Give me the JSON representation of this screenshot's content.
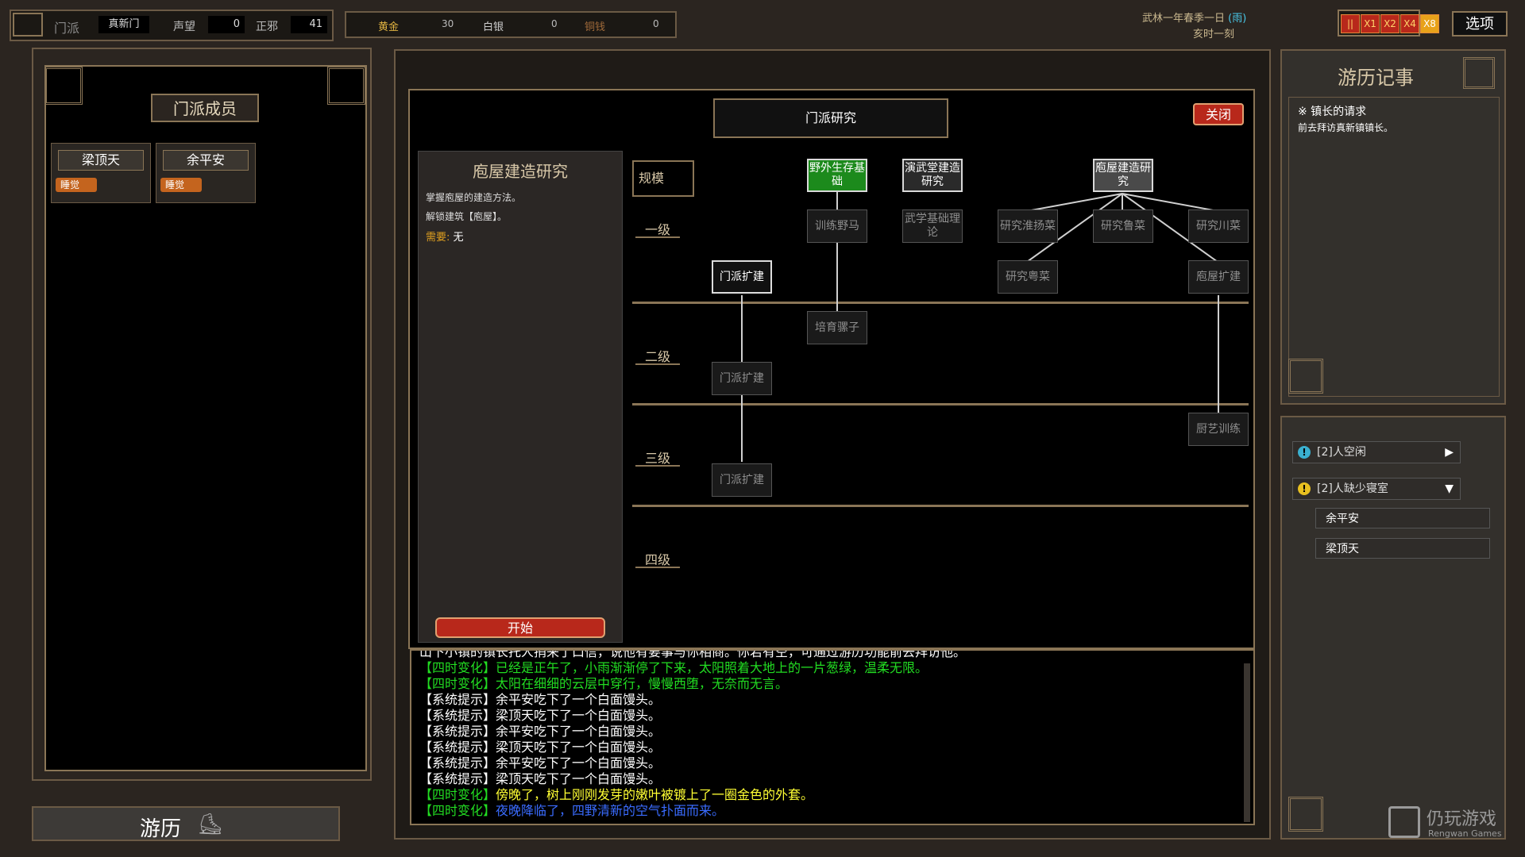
{
  "topbar": {
    "sect_label": "门派",
    "sect_name": "真新门",
    "reputation_label": "声望",
    "reputation_value": "0",
    "alignment_label": "正邪",
    "alignment_value": "41",
    "gold_label": "黄金",
    "gold_value": "30",
    "silver_label": "白银",
    "silver_value": "0",
    "copper_label": "铜钱",
    "copper_value": "0",
    "date": "武林一年春季一日",
    "weather": "(雨)",
    "time": "亥时一刻",
    "speeds": [
      "||",
      "X1",
      "X2",
      "X4",
      "X8"
    ],
    "options_label": "选项"
  },
  "members_panel": {
    "title": "门派成员",
    "members": [
      {
        "name": "梁顶天",
        "status": "睡觉"
      },
      {
        "name": "余平安",
        "status": "睡觉"
      }
    ],
    "travel_label": "游历"
  },
  "research": {
    "window_title": "门派研究",
    "close_label": "关闭",
    "detail_title": "庖屋建造研究",
    "detail_desc1": "掌握庖屋的建造方法。",
    "detail_desc2": "解锁建筑【庖屋】。",
    "require_label": "需要:",
    "require_value": "无",
    "start_label": "开始",
    "scale_label": "规模",
    "levels": [
      "一级",
      "二级",
      "三级",
      "四级"
    ],
    "nodes": {
      "wild": "野外生存基础",
      "martial_hall": "演武堂建造研究",
      "kitchen": "庖屋建造研究",
      "horse": "训练野马",
      "martial_theory": "武学基础理论",
      "huaiyang": "研究淮扬菜",
      "lu": "研究鲁菜",
      "chuan": "研究川菜",
      "expand1": "门派扩建",
      "yue": "研究粤菜",
      "kitchen_expand": "庖屋扩建",
      "mule": "培育骡子",
      "expand2": "门派扩建",
      "chef": "厨艺训练",
      "expand3": "门派扩建"
    }
  },
  "log": {
    "lines": [
      {
        "tag": "",
        "text": "山下小镇的镇长托人捎来了口信，说他有要事与你相商。你若有空，可通过游历功能前去拜访他。",
        "color": "white"
      },
      {
        "tag": "【四时变化】",
        "text": "已经是正午了，小雨渐渐停了下来，太阳照着大地上的一片葱绿，温柔无限。",
        "color": "green"
      },
      {
        "tag": "【四时变化】",
        "text": "太阳在细细的云层中穿行，慢慢西堕，无奈而无言。",
        "color": "green"
      },
      {
        "tag": "【系统提示】",
        "text": "余平安吃下了一个白面馒头。",
        "color": "white"
      },
      {
        "tag": "【系统提示】",
        "text": "梁顶天吃下了一个白面馒头。",
        "color": "white"
      },
      {
        "tag": "【系统提示】",
        "text": "余平安吃下了一个白面馒头。",
        "color": "white"
      },
      {
        "tag": "【系统提示】",
        "text": "梁顶天吃下了一个白面馒头。",
        "color": "white"
      },
      {
        "tag": "【系统提示】",
        "text": "余平安吃下了一个白面馒头。",
        "color": "white"
      },
      {
        "tag": "【系统提示】",
        "text": "梁顶天吃下了一个白面馒头。",
        "color": "white"
      },
      {
        "tag": "【四时变化】",
        "text": "傍晚了，树上刚刚发芽的嫩叶被镀上了一圈金色的外套。",
        "color": "yellow"
      },
      {
        "tag": "【四时变化】",
        "text": "夜晚降临了，四野清新的空气扑面而来。",
        "color": "blue"
      }
    ]
  },
  "journal": {
    "title": "游历记事",
    "entry_title": "※ 镇长的请求",
    "entry_text": "前去拜访真新镇镇长。"
  },
  "alerts": {
    "idle": "[2]人空闲",
    "no_bedroom": "[2]人缺少寝室",
    "no_bedroom_members": [
      "余平安",
      "梁顶天"
    ]
  },
  "watermark": {
    "cn": "仍玩游戏",
    "en": "Rengwan Games"
  }
}
